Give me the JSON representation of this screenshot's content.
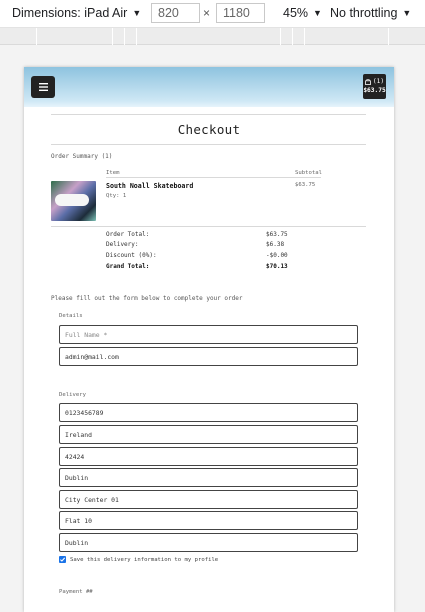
{
  "devtools": {
    "device_label": "Dimensions: iPad Air",
    "width": "820",
    "height": "1180",
    "times": "×",
    "zoom": "45%",
    "throttling": "No throttling",
    "caret": "▼"
  },
  "header": {
    "cart_count": "(1)",
    "cart_total": "$63.75"
  },
  "checkout": {
    "title": "Checkout",
    "order_summary_label": "Order Summary (1)",
    "col_item": "Item",
    "col_subtotal": "Subtotal",
    "product": {
      "name": "South Noall Skateboard",
      "qty": "Qty: 1",
      "subtotal": "$63.75"
    },
    "totals": [
      {
        "label": "Order Total:",
        "value": "$63.75",
        "bold": false
      },
      {
        "label": "Delivery:",
        "value": "$6.38",
        "bold": false
      },
      {
        "label": "Discount (0%):",
        "value": "-$0.00",
        "bold": false
      },
      {
        "label": "Grand Total:",
        "value": "$70.13",
        "bold": true
      }
    ],
    "instructions": "Please fill out the form below to complete your order",
    "details_label": "Details",
    "full_name_placeholder": "Full Name *",
    "email_value": "admin@mail.com",
    "delivery_label": "Delivery",
    "delivery_fields": [
      "0123456789",
      "Ireland",
      "42424",
      "Dublin",
      "City Center 01",
      "Flat 10",
      "Dublin"
    ],
    "save_info_label": "Save this delivery information to my profile",
    "payment_label": "Payment ##"
  }
}
